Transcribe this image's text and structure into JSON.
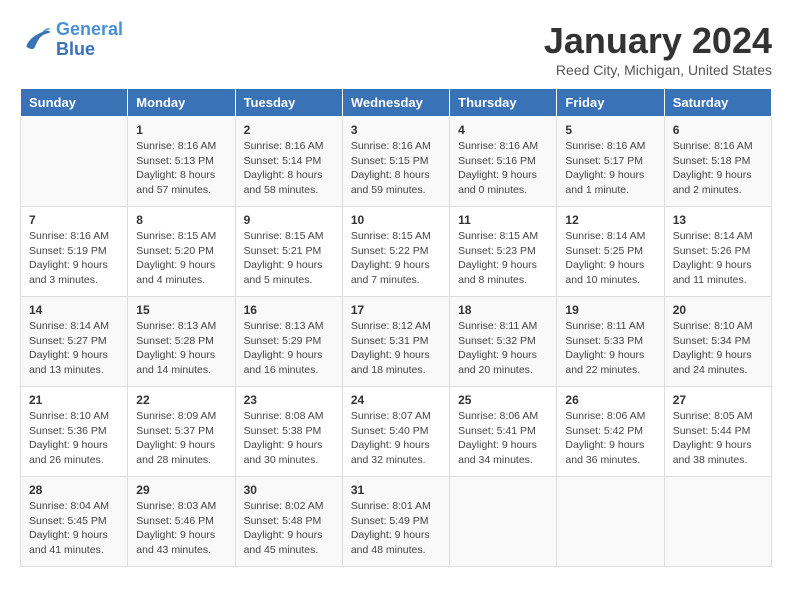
{
  "logo": {
    "line1": "General",
    "line2": "Blue"
  },
  "title": "January 2024",
  "subtitle": "Reed City, Michigan, United States",
  "headers": [
    "Sunday",
    "Monday",
    "Tuesday",
    "Wednesday",
    "Thursday",
    "Friday",
    "Saturday"
  ],
  "weeks": [
    [
      {
        "day": "",
        "info": ""
      },
      {
        "day": "1",
        "info": "Sunrise: 8:16 AM\nSunset: 5:13 PM\nDaylight: 8 hours\nand 57 minutes."
      },
      {
        "day": "2",
        "info": "Sunrise: 8:16 AM\nSunset: 5:14 PM\nDaylight: 8 hours\nand 58 minutes."
      },
      {
        "day": "3",
        "info": "Sunrise: 8:16 AM\nSunset: 5:15 PM\nDaylight: 8 hours\nand 59 minutes."
      },
      {
        "day": "4",
        "info": "Sunrise: 8:16 AM\nSunset: 5:16 PM\nDaylight: 9 hours\nand 0 minutes."
      },
      {
        "day": "5",
        "info": "Sunrise: 8:16 AM\nSunset: 5:17 PM\nDaylight: 9 hours\nand 1 minute."
      },
      {
        "day": "6",
        "info": "Sunrise: 8:16 AM\nSunset: 5:18 PM\nDaylight: 9 hours\nand 2 minutes."
      }
    ],
    [
      {
        "day": "7",
        "info": "Sunrise: 8:16 AM\nSunset: 5:19 PM\nDaylight: 9 hours\nand 3 minutes."
      },
      {
        "day": "8",
        "info": "Sunrise: 8:15 AM\nSunset: 5:20 PM\nDaylight: 9 hours\nand 4 minutes."
      },
      {
        "day": "9",
        "info": "Sunrise: 8:15 AM\nSunset: 5:21 PM\nDaylight: 9 hours\nand 5 minutes."
      },
      {
        "day": "10",
        "info": "Sunrise: 8:15 AM\nSunset: 5:22 PM\nDaylight: 9 hours\nand 7 minutes."
      },
      {
        "day": "11",
        "info": "Sunrise: 8:15 AM\nSunset: 5:23 PM\nDaylight: 9 hours\nand 8 minutes."
      },
      {
        "day": "12",
        "info": "Sunrise: 8:14 AM\nSunset: 5:25 PM\nDaylight: 9 hours\nand 10 minutes."
      },
      {
        "day": "13",
        "info": "Sunrise: 8:14 AM\nSunset: 5:26 PM\nDaylight: 9 hours\nand 11 minutes."
      }
    ],
    [
      {
        "day": "14",
        "info": "Sunrise: 8:14 AM\nSunset: 5:27 PM\nDaylight: 9 hours\nand 13 minutes."
      },
      {
        "day": "15",
        "info": "Sunrise: 8:13 AM\nSunset: 5:28 PM\nDaylight: 9 hours\nand 14 minutes."
      },
      {
        "day": "16",
        "info": "Sunrise: 8:13 AM\nSunset: 5:29 PM\nDaylight: 9 hours\nand 16 minutes."
      },
      {
        "day": "17",
        "info": "Sunrise: 8:12 AM\nSunset: 5:31 PM\nDaylight: 9 hours\nand 18 minutes."
      },
      {
        "day": "18",
        "info": "Sunrise: 8:11 AM\nSunset: 5:32 PM\nDaylight: 9 hours\nand 20 minutes."
      },
      {
        "day": "19",
        "info": "Sunrise: 8:11 AM\nSunset: 5:33 PM\nDaylight: 9 hours\nand 22 minutes."
      },
      {
        "day": "20",
        "info": "Sunrise: 8:10 AM\nSunset: 5:34 PM\nDaylight: 9 hours\nand 24 minutes."
      }
    ],
    [
      {
        "day": "21",
        "info": "Sunrise: 8:10 AM\nSunset: 5:36 PM\nDaylight: 9 hours\nand 26 minutes."
      },
      {
        "day": "22",
        "info": "Sunrise: 8:09 AM\nSunset: 5:37 PM\nDaylight: 9 hours\nand 28 minutes."
      },
      {
        "day": "23",
        "info": "Sunrise: 8:08 AM\nSunset: 5:38 PM\nDaylight: 9 hours\nand 30 minutes."
      },
      {
        "day": "24",
        "info": "Sunrise: 8:07 AM\nSunset: 5:40 PM\nDaylight: 9 hours\nand 32 minutes."
      },
      {
        "day": "25",
        "info": "Sunrise: 8:06 AM\nSunset: 5:41 PM\nDaylight: 9 hours\nand 34 minutes."
      },
      {
        "day": "26",
        "info": "Sunrise: 8:06 AM\nSunset: 5:42 PM\nDaylight: 9 hours\nand 36 minutes."
      },
      {
        "day": "27",
        "info": "Sunrise: 8:05 AM\nSunset: 5:44 PM\nDaylight: 9 hours\nand 38 minutes."
      }
    ],
    [
      {
        "day": "28",
        "info": "Sunrise: 8:04 AM\nSunset: 5:45 PM\nDaylight: 9 hours\nand 41 minutes."
      },
      {
        "day": "29",
        "info": "Sunrise: 8:03 AM\nSunset: 5:46 PM\nDaylight: 9 hours\nand 43 minutes."
      },
      {
        "day": "30",
        "info": "Sunrise: 8:02 AM\nSunset: 5:48 PM\nDaylight: 9 hours\nand 45 minutes."
      },
      {
        "day": "31",
        "info": "Sunrise: 8:01 AM\nSunset: 5:49 PM\nDaylight: 9 hours\nand 48 minutes."
      },
      {
        "day": "",
        "info": ""
      },
      {
        "day": "",
        "info": ""
      },
      {
        "day": "",
        "info": ""
      }
    ]
  ]
}
